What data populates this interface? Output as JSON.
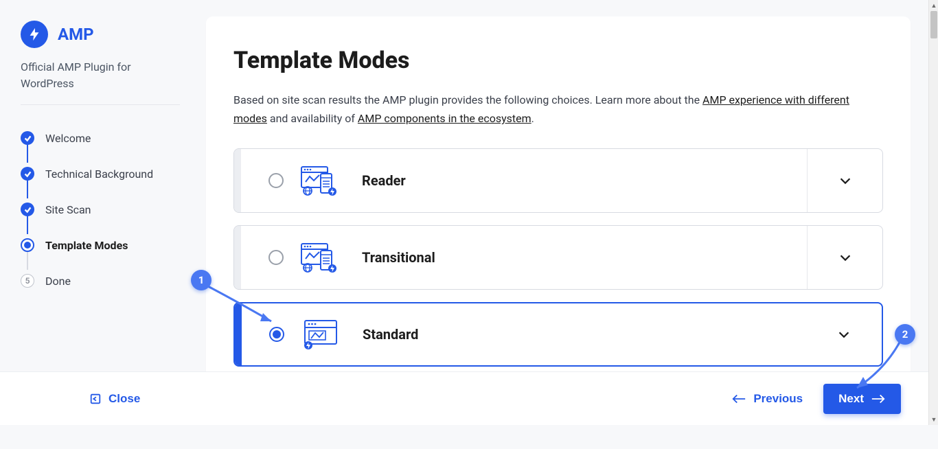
{
  "brand": {
    "name": "AMP",
    "subtitle": "Official AMP Plugin for WordPress"
  },
  "steps": [
    {
      "label": "Welcome",
      "state": "completed"
    },
    {
      "label": "Technical Background",
      "state": "completed"
    },
    {
      "label": "Site Scan",
      "state": "completed"
    },
    {
      "label": "Template Modes",
      "state": "current"
    },
    {
      "label": "Done",
      "state": "pending",
      "num": "5"
    }
  ],
  "page": {
    "title": "Template Modes",
    "intro_pre": "Based on site scan results the AMP plugin provides the following choices. Learn more about the ",
    "link1": "AMP experience with different modes",
    "intro_mid": " and availability of ",
    "link2": "AMP components in the ecosystem",
    "intro_post": "."
  },
  "options": [
    {
      "key": "reader",
      "label": "Reader",
      "selected": false,
      "kind": "reader"
    },
    {
      "key": "transitional",
      "label": "Transitional",
      "selected": false,
      "kind": "reader"
    },
    {
      "key": "standard",
      "label": "Standard",
      "selected": true,
      "kind": "standard"
    }
  ],
  "footer": {
    "close": "Close",
    "previous": "Previous",
    "next": "Next"
  },
  "annotations": [
    {
      "num": "1"
    },
    {
      "num": "2"
    }
  ]
}
